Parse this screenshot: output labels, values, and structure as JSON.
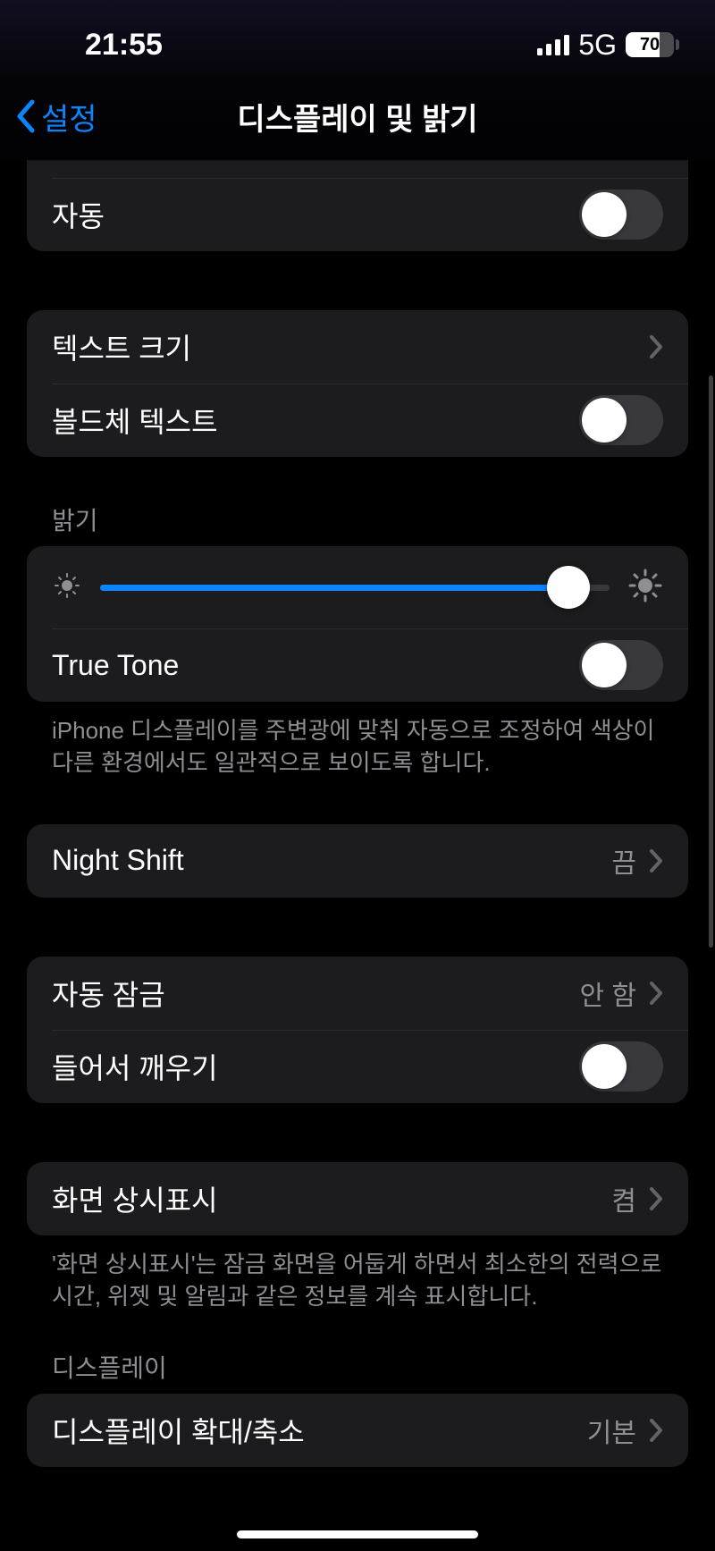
{
  "status": {
    "time": "21:55",
    "network": "5G",
    "battery": "70",
    "batteryPercent": 70
  },
  "nav": {
    "back": "설정",
    "title": "디스플레이 및 밝기"
  },
  "rows": {
    "auto": "자동",
    "textSize": "텍스트 크기",
    "boldText": "볼드체 텍스트",
    "trueTone": "True Tone",
    "nightShift": "Night Shift",
    "nightShiftValue": "끔",
    "autoLock": "자동 잠금",
    "autoLockValue": "안 함",
    "raiseToWake": "들어서 깨우기",
    "alwaysOn": "화면 상시표시",
    "alwaysOnValue": "켬",
    "displayZoom": "디스플레이 확대/축소",
    "displayZoomValue": "기본"
  },
  "headers": {
    "brightness": "밝기",
    "display": "디스플레이"
  },
  "footers": {
    "trueTone": "iPhone 디스플레이를 주변광에 맞춰 자동으로 조정하여 색상이 다른 환경에서도 일관적으로 보이도록 합니다.",
    "alwaysOn": "'화면 상시표시'는 잠금 화면을 어둡게 하면서 최소한의 전력으로 시간, 위젯 및 알림과 같은 정보를 계속 표시합니다."
  },
  "brightnessSliderPercent": 92
}
